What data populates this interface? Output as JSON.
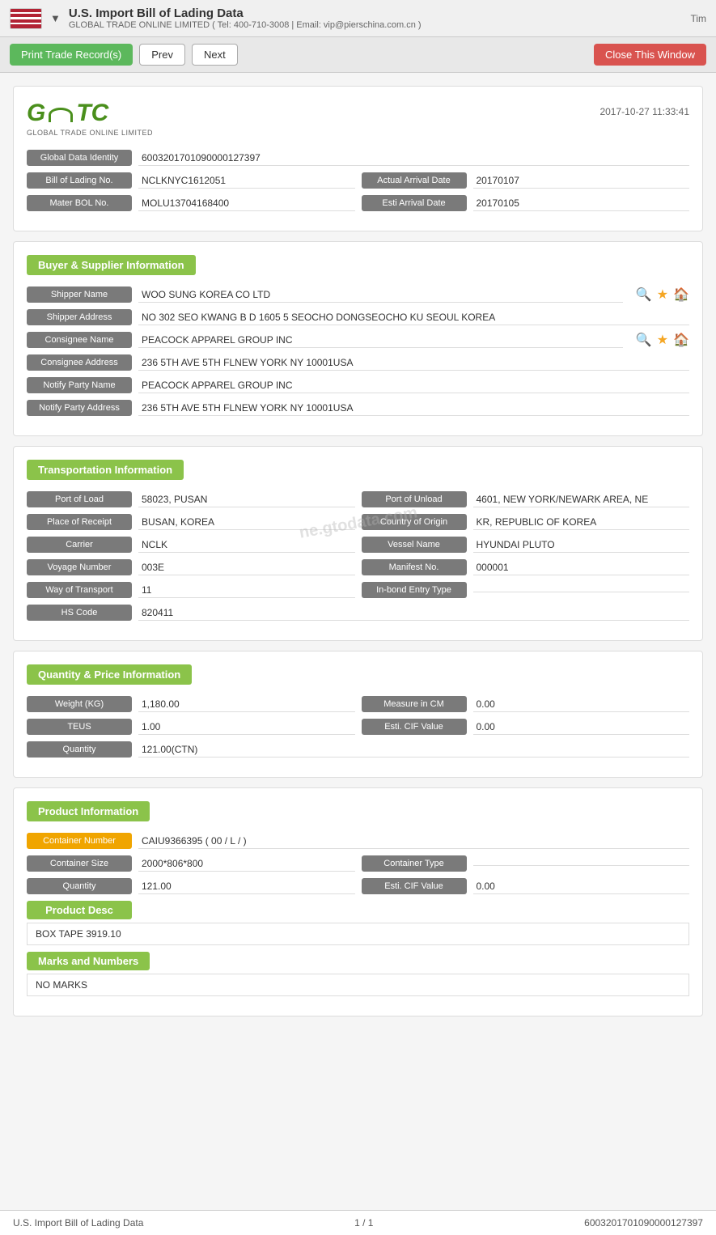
{
  "topBar": {
    "title": "U.S. Import Bill of Lading Data",
    "subtitle": "GLOBAL TRADE ONLINE LIMITED ( Tel: 400-710-3008 | Email: vip@pierschina.com.cn )",
    "time": "Tim"
  },
  "toolbar": {
    "printLabel": "Print Trade Record(s)",
    "prevLabel": "Prev",
    "nextLabel": "Next",
    "closeLabel": "Close This Window"
  },
  "document": {
    "logo": "GTC",
    "logoSubtext": "GLOBAL TRADE ONLINE LIMITED",
    "timestamp": "2017-10-27 11:33:41",
    "globalDataIdentityLabel": "Global Data Identity",
    "globalDataIdentityValue": "6003201701090000127397",
    "billOfLadingLabel": "Bill of Lading No.",
    "billOfLadingValue": "NCLKNYC1612051",
    "actualArrivalDateLabel": "Actual Arrival Date",
    "actualArrivalDateValue": "20170107",
    "masterBolLabel": "Mater BOL No.",
    "masterBolValue": "MOLU13704168400",
    "estiArrivalDateLabel": "Esti Arrival Date",
    "estiArrivalDateValue": "20170105"
  },
  "buyerSupplier": {
    "sectionTitle": "Buyer & Supplier Information",
    "shipperNameLabel": "Shipper Name",
    "shipperNameValue": "WOO SUNG KOREA CO LTD",
    "shipperAddressLabel": "Shipper Address",
    "shipperAddressValue": "NO 302 SEO KWANG B D 1605 5 SEOCHO DONGSEOCHO KU SEOUL KOREA",
    "consigneeNameLabel": "Consignee Name",
    "consigneeNameValue": "PEACOCK APPAREL GROUP INC",
    "consigneeAddressLabel": "Consignee Address",
    "consigneeAddressValue": "236 5TH AVE 5TH FLNEW YORK NY 10001USA",
    "notifyPartyNameLabel": "Notify Party Name",
    "notifyPartyNameValue": "PEACOCK APPAREL GROUP INC",
    "notifyPartyAddressLabel": "Notify Party Address",
    "notifyPartyAddressValue": "236 5TH AVE 5TH FLNEW YORK NY 10001USA"
  },
  "transportation": {
    "sectionTitle": "Transportation Information",
    "portOfLoadLabel": "Port of Load",
    "portOfLoadValue": "58023, PUSAN",
    "portOfUnloadLabel": "Port of Unload",
    "portOfUnloadValue": "4601, NEW YORK/NEWARK AREA, NE",
    "placeOfReceiptLabel": "Place of Receipt",
    "placeOfReceiptValue": "BUSAN, KOREA",
    "countryOfOriginLabel": "Country of Origin",
    "countryOfOriginValue": "KR, REPUBLIC OF KOREA",
    "carrierLabel": "Carrier",
    "carrierValue": "NCLK",
    "vesselNameLabel": "Vessel Name",
    "vesselNameValue": "HYUNDAI PLUTO",
    "voyageNumberLabel": "Voyage Number",
    "voyageNumberValue": "003E",
    "manifestNoLabel": "Manifest No.",
    "manifestNoValue": "000001",
    "wayOfTransportLabel": "Way of Transport",
    "wayOfTransportValue": "11",
    "inBondEntryTypeLabel": "In-bond Entry Type",
    "inBondEntryTypeValue": "",
    "hsCodeLabel": "HS Code",
    "hsCodeValue": "820411"
  },
  "quantityPrice": {
    "sectionTitle": "Quantity & Price Information",
    "weightKgLabel": "Weight (KG)",
    "weightKgValue": "1,180.00",
    "measureInCmLabel": "Measure in CM",
    "measureInCmValue": "0.00",
    "teusLabel": "TEUS",
    "teusValue": "1.00",
    "estiCifValueLabel": "Esti. CIF Value",
    "estiCifValueValue": "0.00",
    "quantityLabel": "Quantity",
    "quantityValue": "121.00(CTN)"
  },
  "productInfo": {
    "sectionTitle": "Product Information",
    "containerNumberLabel": "Container Number",
    "containerNumberValue": "CAIU9366395 ( 00 / L / )",
    "containerSizeLabel": "Container Size",
    "containerSizeValue": "2000*806*800",
    "containerTypeLabel": "Container Type",
    "containerTypeValue": "",
    "quantityLabel": "Quantity",
    "quantityValue": "121.00",
    "estiCifValueLabel": "Esti. CIF Value",
    "estiCifValueValue": "0.00",
    "productDescLabel": "Product Desc",
    "productDescValue": "BOX TAPE 3919.10",
    "marksAndNumbersLabel": "Marks and Numbers",
    "marksAndNumbersValue": "NO MARKS"
  },
  "footer": {
    "leftText": "U.S. Import Bill of Lading Data",
    "centerText": "1 / 1",
    "rightText": "6003201701090000127397"
  }
}
